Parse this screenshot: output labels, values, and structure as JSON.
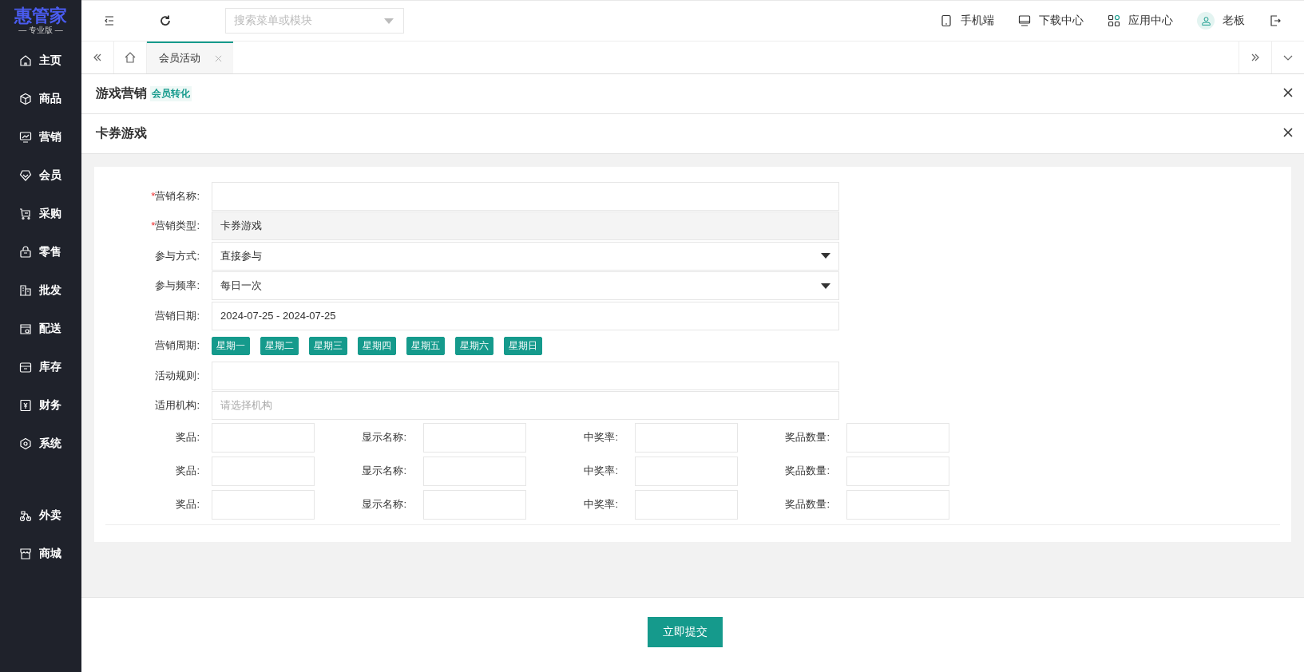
{
  "logo": {
    "name": "惠管家",
    "edition": "— 专业版 —"
  },
  "sidebar": {
    "items": [
      {
        "label": "主页"
      },
      {
        "label": "商品"
      },
      {
        "label": "营销"
      },
      {
        "label": "会员"
      },
      {
        "label": "采购"
      },
      {
        "label": "零售"
      },
      {
        "label": "批发"
      },
      {
        "label": "配送"
      },
      {
        "label": "库存"
      },
      {
        "label": "财务"
      },
      {
        "label": "系统"
      }
    ],
    "bottom_items": [
      {
        "label": "外卖"
      },
      {
        "label": "商城"
      }
    ]
  },
  "top_bar": {
    "search": {
      "placeholder": "搜索菜单或模块"
    },
    "actions": [
      {
        "label": "手机端"
      },
      {
        "label": "下载中心"
      },
      {
        "label": "应用中心"
      },
      {
        "label": "老板"
      }
    ]
  },
  "tabs": [
    {
      "label": "会员活动",
      "selected": true
    }
  ],
  "panels": [
    {
      "title": "游戏营销",
      "tag": "会员转化"
    },
    {
      "title": "卡券游戏"
    }
  ],
  "form": {
    "fields": [
      {
        "label": "营销名称:",
        "required_mark": "*",
        "kind": "input"
      },
      {
        "label": "营销类型:",
        "required_mark": "*",
        "kind": "readonly",
        "value": "卡券游戏"
      },
      {
        "label": "参与方式:",
        "kind": "select",
        "value": "直接参与"
      },
      {
        "label": "参与频率:",
        "kind": "select",
        "value": "每日一次"
      },
      {
        "label": "营销日期:",
        "kind": "input",
        "value": "2024-07-25 - 2024-07-25"
      },
      {
        "label": "营销周期:",
        "kind": "days",
        "days": [
          {
            "label": "星期一",
            "selected": true
          },
          {
            "label": "星期二",
            "selected": true
          },
          {
            "label": "星期三",
            "selected": true
          },
          {
            "label": "星期四",
            "selected": true
          },
          {
            "label": "星期五",
            "selected": true
          },
          {
            "label": "星期六",
            "selected": true
          },
          {
            "label": "星期日",
            "selected": true
          }
        ]
      },
      {
        "label": "活动规则:",
        "kind": "input"
      },
      {
        "label": "适用机构:",
        "kind": "input",
        "placeholder": "请选择机构"
      }
    ],
    "prizes": [
      {
        "prize_label": "奖品:",
        "name_label": "显示名称:",
        "rate_label": "中奖率:",
        "quantity_label": "奖品数量:"
      },
      {
        "prize_label": "奖品:",
        "name_label": "显示名称:",
        "rate_label": "中奖率:",
        "quantity_label": "奖品数量:"
      },
      {
        "prize_label": "奖品:",
        "name_label": "显示名称:",
        "rate_label": "中奖率:",
        "quantity_label": "奖品数量:"
      }
    ]
  },
  "submit": "立即提交"
}
